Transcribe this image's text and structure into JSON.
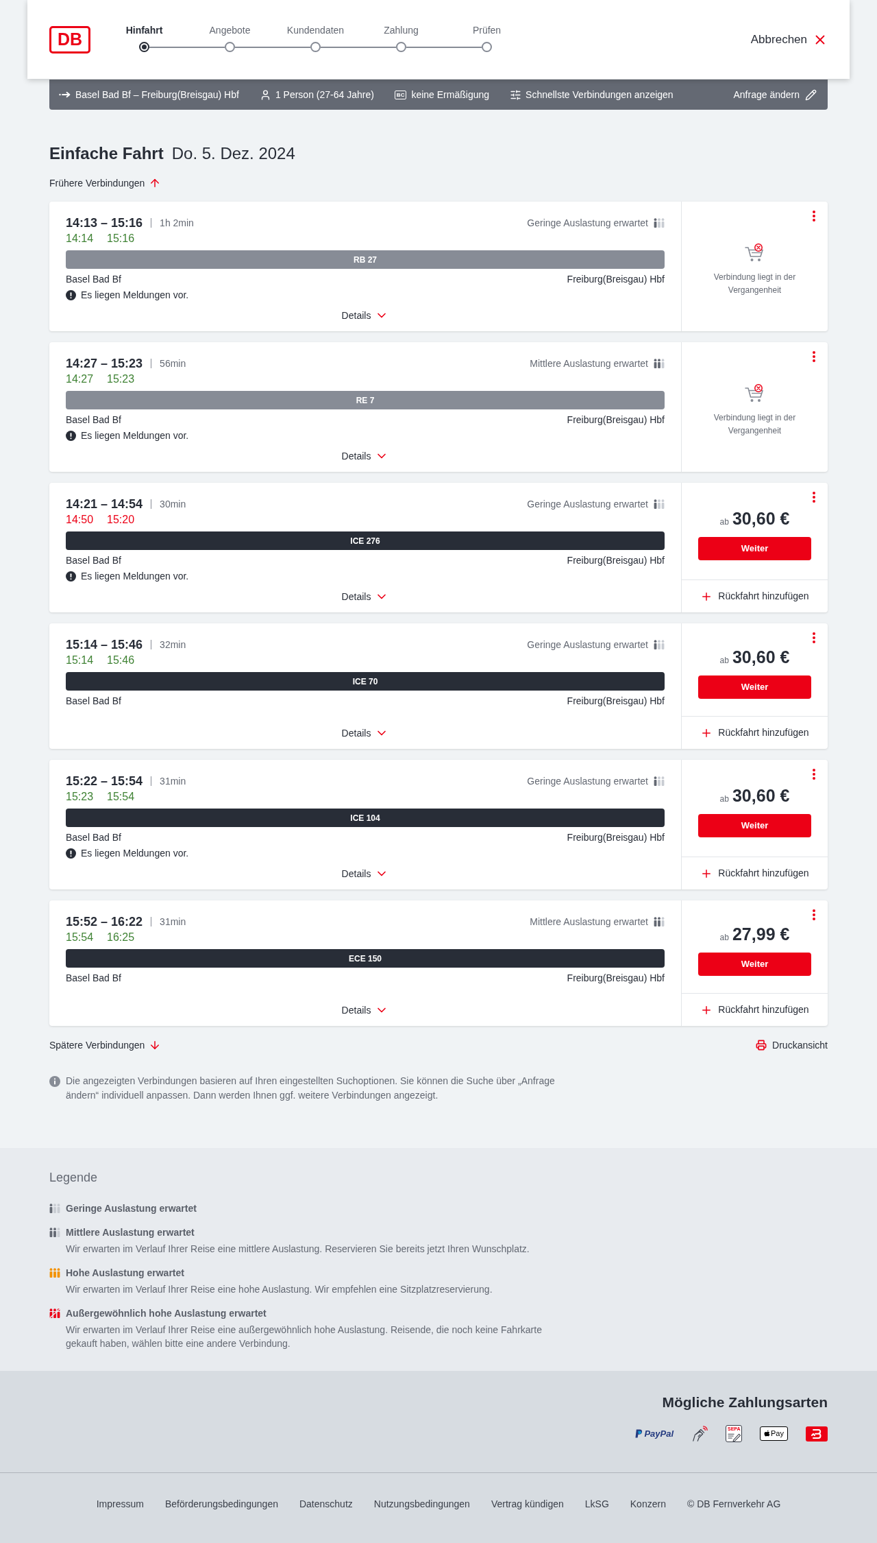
{
  "header": {
    "logo": "DB",
    "steps": [
      {
        "label": "Hinfahrt",
        "selected": true
      },
      {
        "label": "Angebote",
        "selected": false
      },
      {
        "label": "Kundendaten",
        "selected": false
      },
      {
        "label": "Zahlung",
        "selected": false
      },
      {
        "label": "Prüfen",
        "selected": false
      }
    ],
    "cancel": "Abbrechen"
  },
  "search_summary": {
    "route": "Basel Bad Bf – Freiburg(Breisgau) Hbf",
    "passengers": "1 Person (27-64 Jahre)",
    "card_badge": "BC",
    "discount": "keine Ermäßigung",
    "option": "Schnellste Verbindungen anzeigen",
    "edit": "Anfrage ändern"
  },
  "heading": {
    "title": "Einfache Fahrt",
    "date": "Do. 5. Dez. 2024"
  },
  "earlier_link": "Frühere Verbindungen",
  "connections": [
    {
      "planned": "14:13 – 15:16",
      "duration": "1h 2min",
      "occupancy": {
        "kind": "low",
        "label": "Geringe Auslastung erwartet"
      },
      "actual_departure": "14:14",
      "actual_arrival": "15:16",
      "delayed": false,
      "train": "RB 27",
      "from": "Basel Bad Bf",
      "to": "Freiburg(Breisgau) Hbf",
      "notice": "Es liegen Meldungen vor.",
      "details": "Details",
      "offer": {
        "kind": "past",
        "message": "Verbindung liegt in der Vergangenheit"
      }
    },
    {
      "planned": "14:27 – 15:23",
      "duration": "56min",
      "occupancy": {
        "kind": "medium",
        "label": "Mittlere Auslastung erwartet"
      },
      "actual_departure": "14:27",
      "actual_arrival": "15:23",
      "delayed": false,
      "train": "RE 7",
      "from": "Basel Bad Bf",
      "to": "Freiburg(Breisgau) Hbf",
      "notice": "Es liegen Meldungen vor.",
      "details": "Details",
      "offer": {
        "kind": "past",
        "message": "Verbindung liegt in der Vergangenheit"
      }
    },
    {
      "planned": "14:21 – 14:54",
      "duration": "30min",
      "occupancy": {
        "kind": "low",
        "label": "Geringe Auslastung erwartet"
      },
      "actual_departure": "14:50",
      "actual_arrival": "15:20",
      "delayed": true,
      "train": "ICE 276",
      "from": "Basel Bad Bf",
      "to": "Freiburg(Breisgau) Hbf",
      "notice": "Es liegen Meldungen vor.",
      "details": "Details",
      "offer": {
        "kind": "price",
        "prefix": "ab",
        "price": "30,60 €",
        "button": "Weiter",
        "return_link": "Rückfahrt hinzufügen"
      }
    },
    {
      "planned": "15:14 – 15:46",
      "duration": "32min",
      "occupancy": {
        "kind": "low",
        "label": "Geringe Auslastung erwartet"
      },
      "actual_departure": "15:14",
      "actual_arrival": "15:46",
      "delayed": false,
      "train": "ICE 70",
      "from": "Basel Bad Bf",
      "to": "Freiburg(Breisgau) Hbf",
      "details": "Details",
      "offer": {
        "kind": "price",
        "prefix": "ab",
        "price": "30,60 €",
        "button": "Weiter",
        "return_link": "Rückfahrt hinzufügen"
      }
    },
    {
      "planned": "15:22 – 15:54",
      "duration": "31min",
      "occupancy": {
        "kind": "low",
        "label": "Geringe Auslastung erwartet"
      },
      "actual_departure": "15:23",
      "actual_arrival": "15:54",
      "delayed": false,
      "train": "ICE 104",
      "from": "Basel Bad Bf",
      "to": "Freiburg(Breisgau) Hbf",
      "notice": "Es liegen Meldungen vor.",
      "details": "Details",
      "offer": {
        "kind": "price",
        "prefix": "ab",
        "price": "30,60 €",
        "button": "Weiter",
        "return_link": "Rückfahrt hinzufügen"
      }
    },
    {
      "planned": "15:52 – 16:22",
      "duration": "31min",
      "occupancy": {
        "kind": "medium",
        "label": "Mittlere Auslastung erwartet"
      },
      "actual_departure": "15:54",
      "actual_arrival": "16:25",
      "delayed": false,
      "train": "ECE 150",
      "from": "Basel Bad Bf",
      "to": "Freiburg(Breisgau) Hbf",
      "details": "Details",
      "offer": {
        "kind": "price",
        "prefix": "ab",
        "price": "27,99 €",
        "button": "Weiter",
        "return_link": "Rückfahrt hinzufügen"
      }
    }
  ],
  "later_link": "Spätere Verbindungen",
  "print_link": "Druckansicht",
  "info_note": "Die angezeigten Verbindungen basieren auf Ihren eingestellten Suchoptionen. Sie können die Suche über „Anfrage ändern“ individuell anpassen. Dann werden Ihnen ggf. weitere Verbindungen angezeigt.",
  "legend": {
    "title": "Legende",
    "items": [
      {
        "kind": "low",
        "title": "Geringe Auslastung erwartet"
      },
      {
        "kind": "medium",
        "title": "Mittlere Auslastung erwartet",
        "text": "Wir erwarten im Verlauf Ihrer Reise eine mittlere Auslastung. Reservieren Sie bereits jetzt Ihren Wunschplatz."
      },
      {
        "kind": "high",
        "title": "Hohe Auslastung erwartet",
        "text": "Wir erwarten im Verlauf Ihrer Reise eine hohe Auslastung. Wir empfehlen eine Sitzplatzreservierung."
      },
      {
        "kind": "extreme",
        "title": "Außergewöhnlich hohe Auslastung erwartet",
        "text": "Wir erwarten im Verlauf Ihrer Reise eine außergewöhnlich hohe Auslastung. Reisende, die noch keine Fahrkarte gekauft haben, wählen bitte eine andere Verbindung."
      }
    ]
  },
  "payment": {
    "title": "Mögliche Zahlungsarten",
    "methods": [
      {
        "kind": "paypal",
        "label": "PayPal"
      },
      {
        "kind": "contactless"
      },
      {
        "kind": "sepa",
        "label": "SEPA"
      },
      {
        "kind": "applepay",
        "label": "Pay"
      },
      {
        "kind": "db"
      }
    ]
  },
  "footer_links": [
    "Impressum",
    "Beförderungsbedingungen",
    "Datenschutz",
    "Nutzungsbedingungen",
    "Vertrag kündigen",
    "LkSG",
    "Konzern",
    "© DB Fernverkehr AG"
  ]
}
